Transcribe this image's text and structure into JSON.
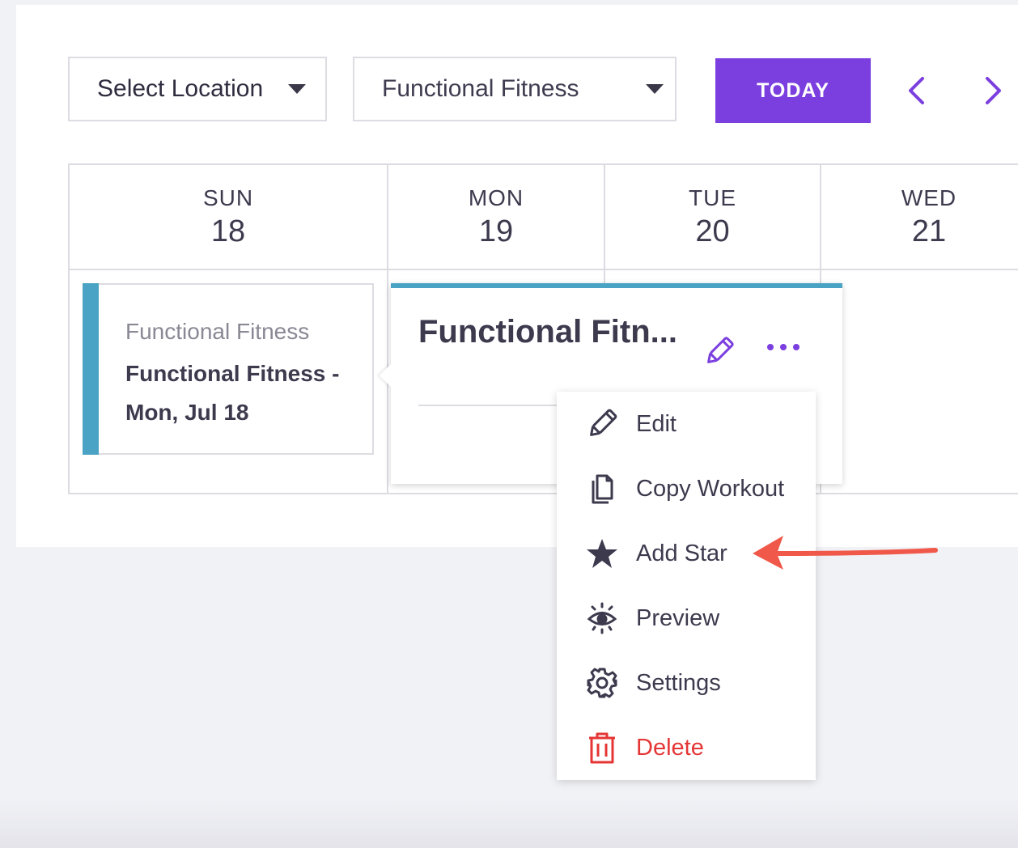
{
  "filters": {
    "location_label": "Select Location",
    "program_label": "Functional Fitness",
    "today_label": "TODAY"
  },
  "calendar": {
    "days": [
      {
        "name": "SUN",
        "num": "18"
      },
      {
        "name": "MON",
        "num": "19"
      },
      {
        "name": "TUE",
        "num": "20"
      },
      {
        "name": "WED",
        "num": "21"
      }
    ]
  },
  "event": {
    "program": "Functional Fitness",
    "title": "Functional Fitness - Mon, Jul 18"
  },
  "popover": {
    "title": "Functional Fitn..."
  },
  "menu": {
    "items": [
      {
        "label": "Edit",
        "icon": "pencil-icon"
      },
      {
        "label": "Copy Workout",
        "icon": "copy-icon"
      },
      {
        "label": "Add Star",
        "icon": "star-icon"
      },
      {
        "label": "Preview",
        "icon": "eye-icon"
      },
      {
        "label": "Settings",
        "icon": "gear-icon"
      },
      {
        "label": "Delete",
        "icon": "trash-icon"
      }
    ]
  },
  "colors": {
    "accent": "#7b3fe0",
    "event_stripe": "#4aa3c4",
    "danger": "#e53535",
    "annotation_arrow": "#f0594a"
  }
}
